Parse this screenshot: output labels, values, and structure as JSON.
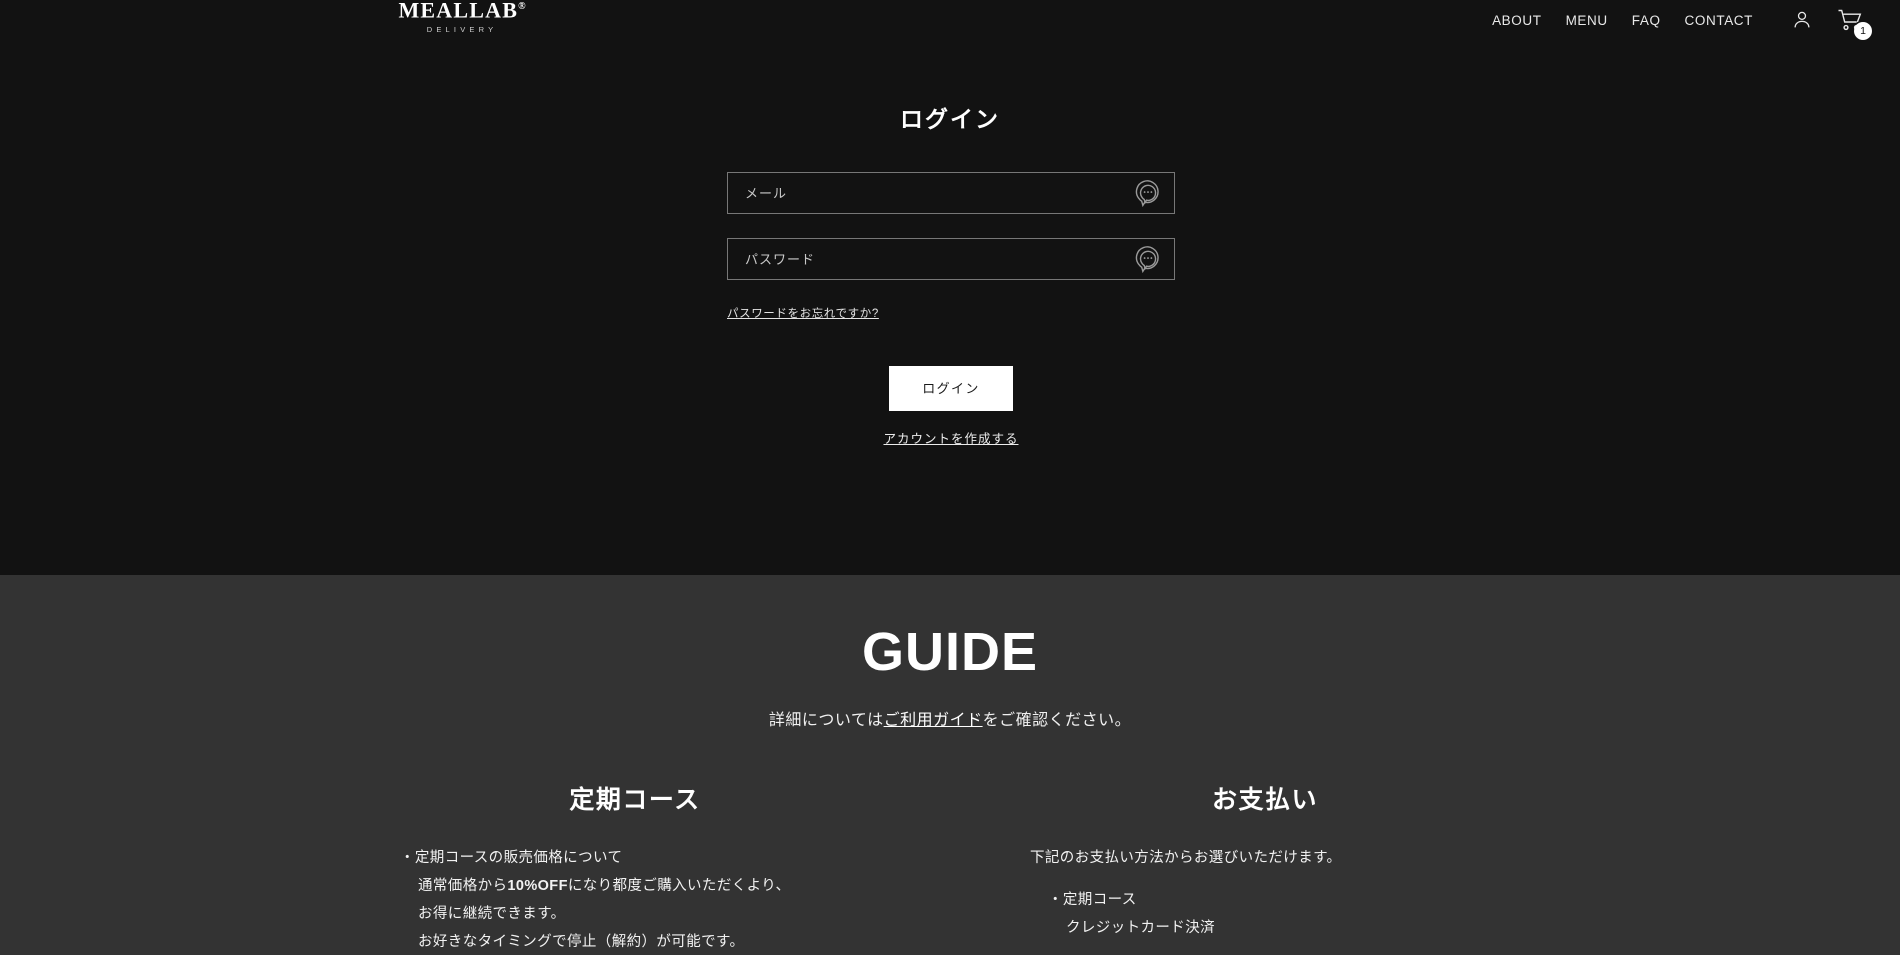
{
  "header": {
    "brand": {
      "name": "MEALLAB",
      "registered": "®",
      "sub": "DELIVERY"
    },
    "nav": [
      {
        "label": "ABOUT",
        "name": "nav-link-about"
      },
      {
        "label": "MENU",
        "name": "nav-link-menu"
      },
      {
        "label": "FAQ",
        "name": "nav-link-faq"
      },
      {
        "label": "CONTACT",
        "name": "nav-link-contact"
      }
    ],
    "account_icon": "person-icon",
    "cart_icon": "shopping-cart-icon",
    "cart_count": "1"
  },
  "login": {
    "title": "ログイン",
    "email": {
      "placeholder": "メール",
      "value": "",
      "icon": "chat-dots-icon"
    },
    "password": {
      "placeholder": "パスワード",
      "value": "",
      "icon": "chat-dots-icon"
    },
    "forgot_label": "パスワードをお忘れですか?",
    "submit_label": "ログイン",
    "create_account_label": "アカウントを作成する"
  },
  "guide": {
    "title": "GUIDE",
    "subtitle_before": "詳細については",
    "subtitle_link": "ご利用ガイド",
    "subtitle_after": "をご確認ください。",
    "columns": [
      {
        "title": "定期コース",
        "line1": "・定期コースの販売価格について",
        "line2_pre": "通常価格から",
        "line2_bold": "10%OFF",
        "line2_post": "になり都度ご購入いただくより、",
        "line3": "お得に継続できます。",
        "line4": "お好きなタイミングで停止（解約）が可能です。"
      },
      {
        "title": "お支払い",
        "line1": "下記のお支払い方法からお選びいただけます。",
        "line2": "・定期コース",
        "line3": "クレジットカード決済"
      }
    ]
  },
  "colors": {
    "hero_bg": "#121212",
    "guide_bg": "#333333",
    "accent": "#ffffff",
    "border": "#777777"
  }
}
